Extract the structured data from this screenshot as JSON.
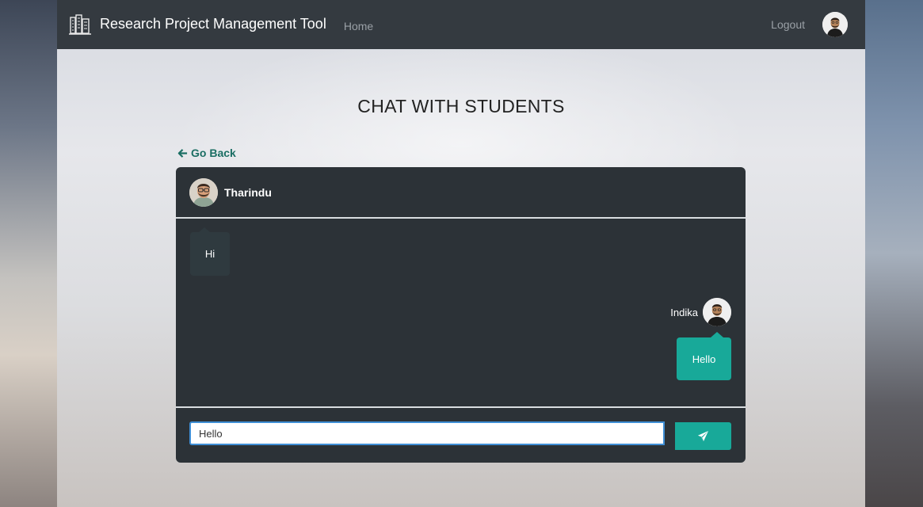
{
  "navbar": {
    "brand_title": "Research Project Management Tool",
    "home_label": "Home",
    "logout_label": "Logout",
    "logo_icon": "building-logo-icon",
    "user_avatar_icon": "user-avatar-icon"
  },
  "page": {
    "title": "CHAT WITH STUDENTS",
    "go_back_label": "Go Back",
    "go_back_icon": "arrow-left-icon"
  },
  "chat": {
    "contact_name": "Tharindu",
    "messages": [
      {
        "direction": "received",
        "text": "Hi"
      },
      {
        "direction": "sent",
        "sender": "Indika",
        "text": "Hello"
      }
    ],
    "input_value": "Hello",
    "send_icon": "paper-plane-icon"
  },
  "colors": {
    "navbar_bg": "#343a40",
    "chat_bg": "#2c3237",
    "accent": "#18a999",
    "link": "#1b6e63",
    "input_border": "#3f8fd6"
  }
}
